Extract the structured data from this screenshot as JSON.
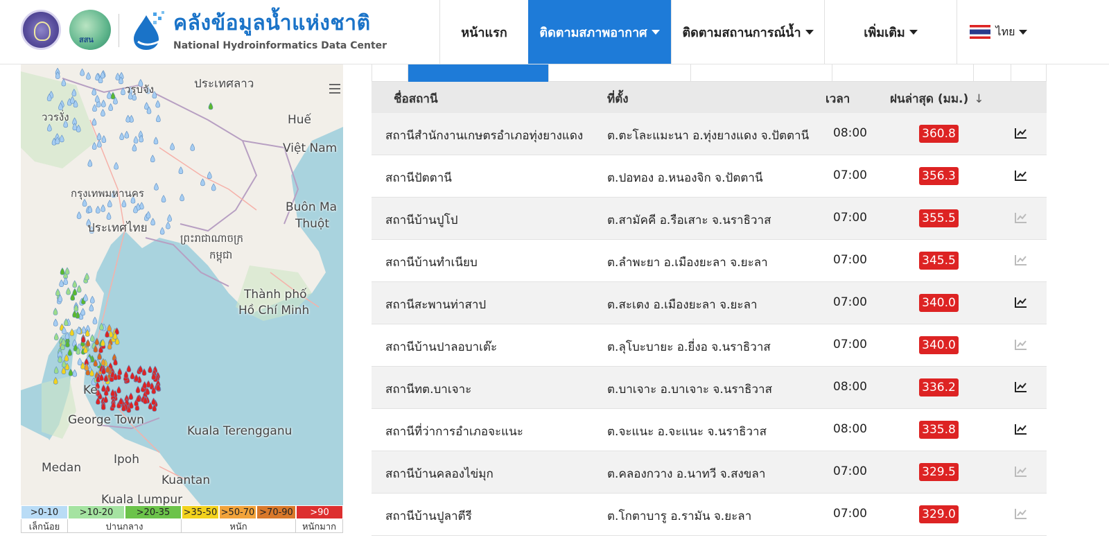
{
  "header": {
    "logo1_name": "university-seal",
    "logo2_text": "สสน",
    "title": "คลังข้อมูลน้ำแห่งชาติ",
    "subtitle": "National Hydroinformatics Data Center",
    "nav": [
      {
        "label": "หน้าแรก",
        "dropdown": false,
        "active": false
      },
      {
        "label": "ติดตามสภาพอากาศ",
        "dropdown": true,
        "active": true
      },
      {
        "label": "ติดตามสถานการณ์น้ำ",
        "dropdown": true,
        "active": false
      },
      {
        "label": "เพิ่มเติม",
        "dropdown": true,
        "active": false
      }
    ],
    "language": "ไทย",
    "accent_color": "#1e7bd8"
  },
  "map": {
    "labels": {
      "laos": "ประเทศลาว",
      "luang_prabang": "วรฺบจัง",
      "city_nw": "ววรงั่ง",
      "hue": "Huế",
      "vietnam": "Việt Nam",
      "bangkok": "กรุงเทพมหานคร",
      "thailand": "ประเทศไทย",
      "cambodia1": "ព្រះរាជាណាចក្រ",
      "cambodia2": "កម្ពុជា",
      "buon_ma": "Buôn Ma",
      "thuot": "Thuột",
      "hcm1": "Thành phố",
      "hcm2": "Hồ Chí Minh",
      "george_town": "George Town",
      "kuala_terengganu": "Kuala Terengganu",
      "medan": "Medan",
      "ipoh": "Ipoh",
      "kuantan": "Kuantan",
      "kuala_lumpur": "Kuala Lumpur",
      "kedah_abbrev": "Ke"
    },
    "marker_colors": {
      "light": "#a6cdf2",
      "light_green": "#9ddc8a",
      "green": "#5cb82f",
      "yellow": "#f3d21d",
      "orange": "#ef9a2a",
      "dark_orange": "#d76a1f",
      "red": "#dd2323"
    }
  },
  "legend": {
    "ranges": [
      {
        "label": ">0-10",
        "color": "#b9dcf6"
      },
      {
        "label": ">10-20",
        "color": "#a5e3a1"
      },
      {
        "label": ">20-35",
        "color": "#6cc34a"
      },
      {
        "label": ">35-50",
        "color": "#f3d21d"
      },
      {
        "label": ">50-70",
        "color": "#f2a33a"
      },
      {
        "label": ">70-90",
        "color": "#d9782a"
      },
      {
        "label": ">90",
        "color": "#dd2f2f"
      }
    ],
    "categories": [
      "เล็กน้อย",
      "ปานกลาง",
      "หนัก",
      "หนักมาก"
    ]
  },
  "table": {
    "columns": {
      "station": "ชื่อสถานี",
      "location": "ที่ตั้ง",
      "time": "เวลา",
      "rain": "ฝนล่าสุด (มม.)",
      "sort_icon": "arrow-down-icon"
    },
    "badge_color": "#dd2323",
    "rows": [
      {
        "station": "สถานีสำนักงานเกษตรอำเภอทุ่งยางแดง",
        "location": "ต.ตะโละแมะนา อ.ทุ่งยางแดง จ.ปัตตานี",
        "time": "08:00",
        "rain": "360.8",
        "graph_active": true
      },
      {
        "station": "สถานีปัตตานี",
        "location": "ต.ปอทอง อ.หนองจิก จ.ปัตตานี",
        "time": "07:00",
        "rain": "356.3",
        "graph_active": true
      },
      {
        "station": "สถานีบ้านปูโป",
        "location": "ต.สามัคคี อ.รือเสาะ จ.นราธิวาส",
        "time": "07:00",
        "rain": "355.5",
        "graph_active": false
      },
      {
        "station": "สถานีบ้านทำเนียบ",
        "location": "ต.ลำพะยา อ.เมืองยะลา จ.ยะลา",
        "time": "07:00",
        "rain": "345.5",
        "graph_active": false
      },
      {
        "station": "สถานีสะพานท่าสาป",
        "location": "ต.สะเตง อ.เมืองยะลา จ.ยะลา",
        "time": "07:00",
        "rain": "340.0",
        "graph_active": true
      },
      {
        "station": "สถานีบ้านปาลอบาเต๊ะ",
        "location": "ต.ลุโบะบายะ อ.ยี่งอ จ.นราธิวาส",
        "time": "07:00",
        "rain": "340.0",
        "graph_active": false
      },
      {
        "station": "สถานีทต.บาเจาะ",
        "location": "ต.บาเจาะ อ.บาเจาะ จ.นราธิวาส",
        "time": "08:00",
        "rain": "336.2",
        "graph_active": true
      },
      {
        "station": "สถานีที่ว่าการอำเภอจะแนะ",
        "location": "ต.จะแนะ อ.จะแนะ จ.นราธิวาส",
        "time": "08:00",
        "rain": "335.8",
        "graph_active": true
      },
      {
        "station": "สถานีบ้านคลองไข่มุก",
        "location": "ต.คลองกวาง อ.นาทวี จ.สงขลา",
        "time": "07:00",
        "rain": "329.5",
        "graph_active": false
      },
      {
        "station": "สถานีบ้านปูลาตีรี",
        "location": "ต.โกตาบารู อ.รามัน จ.ยะลา",
        "time": "07:00",
        "rain": "329.0",
        "graph_active": false
      }
    ]
  }
}
